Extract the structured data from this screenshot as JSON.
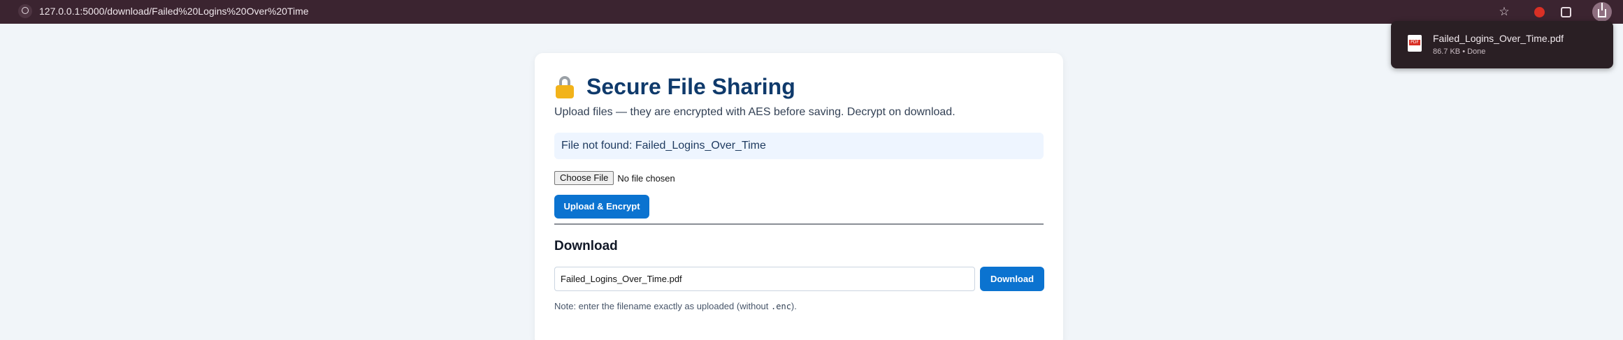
{
  "browser": {
    "url": "127.0.0.1:5000/download/Failed%20Logins%20Over%20Time"
  },
  "download_bubble": {
    "filename": "Failed_Logins_Over_Time.pdf",
    "meta": "86.7 KB • Done",
    "icon_label": "PDF"
  },
  "page": {
    "title": "Secure File Sharing",
    "subtitle": "Upload files — they are encrypted with AES before saving. Decrypt on download.",
    "notice": "File not found: Failed_Logins_Over_Time",
    "file_input": {
      "button_label": "Choose File",
      "status": "No file chosen"
    },
    "upload_button": "Upload & Encrypt",
    "download_section": {
      "heading": "Download",
      "input_value": "Failed_Logins_Over_Time.pdf",
      "button_label": "Download",
      "note_prefix": "Note: enter the filename exactly as uploaded (without ",
      "note_code": ".enc",
      "note_suffix": ")."
    }
  },
  "colors": {
    "accent": "#0b73d0",
    "title": "#0f3a6b",
    "notice_bg": "#eef5ff"
  }
}
